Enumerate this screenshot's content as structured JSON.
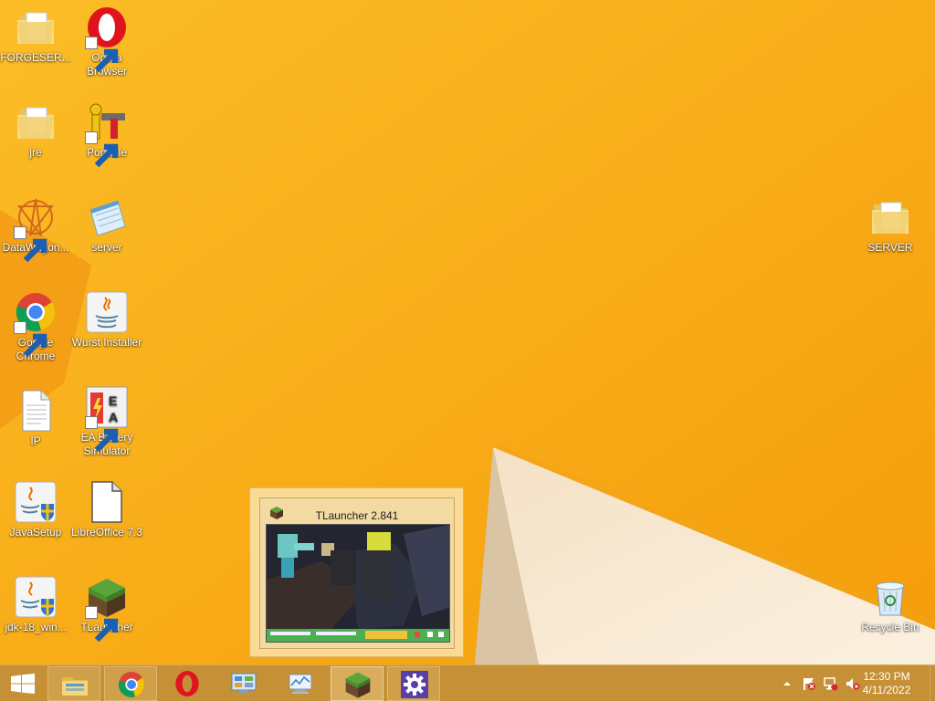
{
  "desktop_icons_left": [
    {
      "label": "FORGESER...",
      "icon": "folder-icon"
    },
    {
      "label": "Opera Browser",
      "icon": "opera-icon"
    },
    {
      "label": "jre",
      "icon": "folder-icon"
    },
    {
      "label": "Portecle",
      "icon": "portecle-icon"
    },
    {
      "label": "DataWagon...",
      "icon": "datawagon-icon"
    },
    {
      "label": "server",
      "icon": "notepad-icon"
    },
    {
      "label": "Google Chrome",
      "icon": "chrome-icon"
    },
    {
      "label": "Wurst Installer",
      "icon": "java-icon"
    },
    {
      "label": "IP",
      "icon": "text-file-icon"
    },
    {
      "label": "EA Battery Simulator",
      "icon": "ea-battery-icon"
    },
    {
      "label": "JavaSetup",
      "icon": "java-setup-icon"
    },
    {
      "label": "LibreOffice 7.3",
      "icon": "libreoffice-icon"
    },
    {
      "label": "jdk-18_win...",
      "icon": "java-setup-icon"
    },
    {
      "label": "TLauncher",
      "icon": "grass-block-icon"
    }
  ],
  "desktop_icons_right": [
    {
      "label": "SERVER",
      "icon": "folder-icon"
    },
    {
      "label": "Recycle Bin",
      "icon": "recycle-bin-icon"
    }
  ],
  "preview": {
    "title": "TLauncher 2.841",
    "close_glyph": "✕"
  },
  "taskbar": {
    "pinned": [
      {
        "name": "file-explorer",
        "icon": "file-explorer-icon"
      },
      {
        "name": "chrome",
        "icon": "chrome-icon"
      },
      {
        "name": "opera",
        "icon": "opera-icon"
      },
      {
        "name": "control-panel",
        "icon": "control-panel-icon"
      },
      {
        "name": "performance",
        "icon": "performance-icon"
      },
      {
        "name": "tlauncher",
        "icon": "grass-block-icon",
        "active": true
      },
      {
        "name": "settings",
        "icon": "gear-icon"
      }
    ]
  },
  "tray": {
    "time": "12:30 PM",
    "date": "4/11/2022"
  },
  "colors": {
    "wallpaper": "#f8ad14",
    "taskbar": "#c48f38",
    "accent": "#ffffff"
  }
}
